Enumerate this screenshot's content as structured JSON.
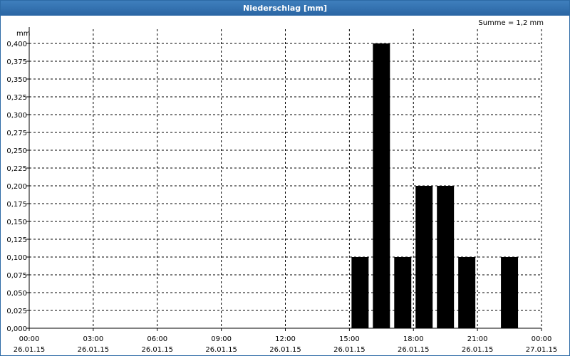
{
  "window": {
    "title": "Niederschlag [mm]"
  },
  "summary": "Summe = 1,2 mm",
  "chart_data": {
    "type": "bar",
    "title": "Niederschlag [mm]",
    "ylabel": "mm",
    "ylim": [
      0,
      0.4
    ],
    "y_ticks": [
      "0,000",
      "0,025",
      "0,050",
      "0,075",
      "0,100",
      "0,125",
      "0,150",
      "0,175",
      "0,200",
      "0,225",
      "0,250",
      "0,275",
      "0,300",
      "0,325",
      "0,350",
      "0,375",
      "0,400"
    ],
    "x_range_hours": [
      0,
      24
    ],
    "x_ticks": [
      {
        "time": "00:00",
        "date": "26.01.15"
      },
      {
        "time": "03:00",
        "date": "26.01.15"
      },
      {
        "time": "06:00",
        "date": "26.01.15"
      },
      {
        "time": "09:00",
        "date": "26.01.15"
      },
      {
        "time": "12:00",
        "date": "26.01.15"
      },
      {
        "time": "15:00",
        "date": "26.01.15"
      },
      {
        "time": "18:00",
        "date": "26.01.15"
      },
      {
        "time": "21:00",
        "date": "26.01.15"
      },
      {
        "time": "00:00",
        "date": "27.01.15"
      }
    ],
    "bars": [
      {
        "start": "15:00",
        "end": "16:00",
        "value": 0.1
      },
      {
        "start": "16:00",
        "end": "17:00",
        "value": 0.4
      },
      {
        "start": "17:00",
        "end": "18:00",
        "value": 0.1
      },
      {
        "start": "18:00",
        "end": "19:00",
        "value": 0.2
      },
      {
        "start": "19:00",
        "end": "20:00",
        "value": 0.2
      },
      {
        "start": "20:00",
        "end": "21:00",
        "value": 0.1
      },
      {
        "start": "22:00",
        "end": "23:00",
        "value": 0.1
      }
    ],
    "grid": true,
    "bar_color": "#000000"
  }
}
